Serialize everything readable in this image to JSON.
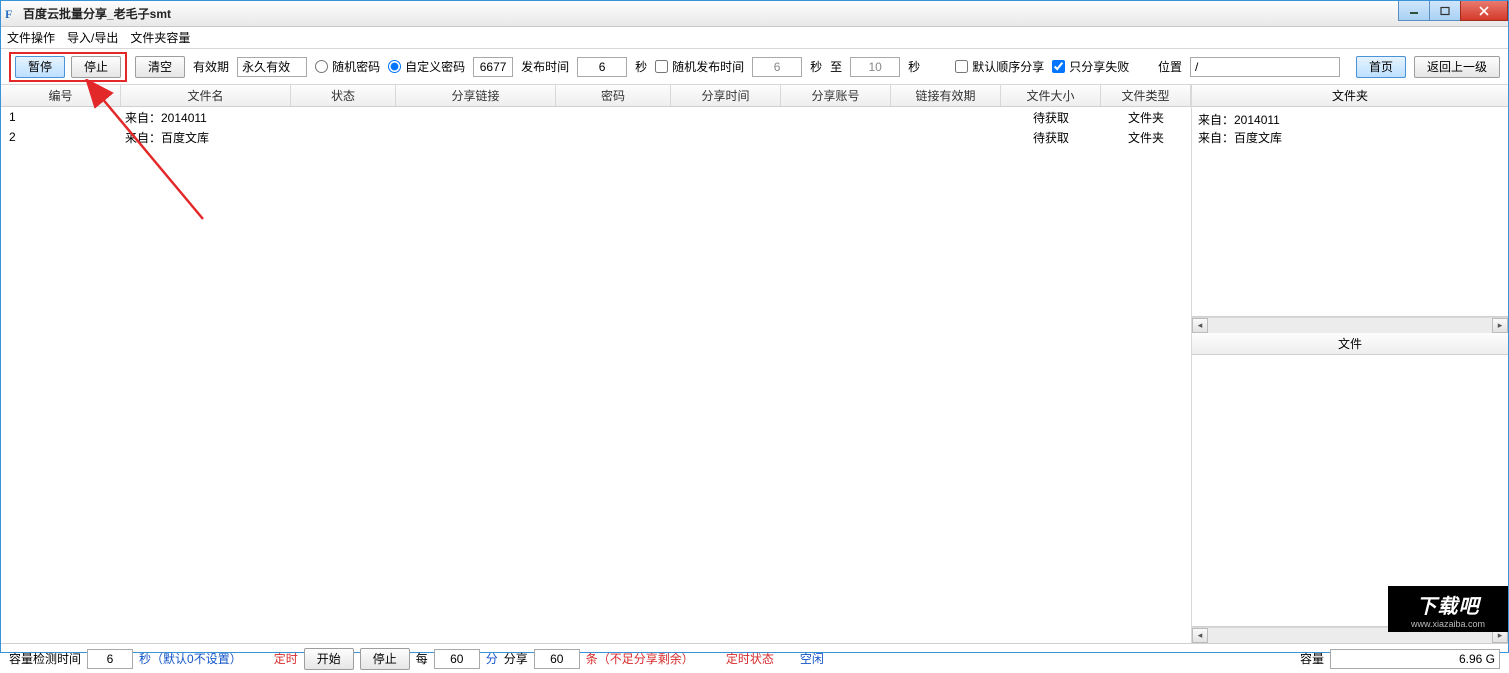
{
  "window": {
    "title": "百度云批量分享_老毛子smt"
  },
  "menu": {
    "file": "文件操作",
    "io": "导入/导出",
    "cap": "文件夹容量"
  },
  "toolbar": {
    "pause": "暂停",
    "stop": "停止",
    "clear": "清空",
    "expiry_label": "有效期",
    "expiry_value": "永久有效",
    "rand_pwd": "随机密码",
    "custom_pwd": "自定义密码",
    "pwd_value": "6677",
    "pub_time_label": "发布时间",
    "pub_time_value": "6",
    "sec": "秒",
    "rand_pub": "随机发布时间",
    "rand_from": "6",
    "to_label": "至",
    "rand_to": "10",
    "sec2": "秒",
    "default_order": "默认顺序分享",
    "only_failed": "只分享失败",
    "loc_label": "位置",
    "loc_value": "/",
    "home": "首页",
    "back": "返回上一级"
  },
  "columns": {
    "id": "编号",
    "name": "文件名",
    "status": "状态",
    "link": "分享链接",
    "pwd": "密码",
    "time": "分享时间",
    "acct": "分享账号",
    "linkexp": "链接有效期",
    "size": "文件大小",
    "type": "文件类型"
  },
  "rows": [
    {
      "id": "1",
      "name": "来自：2014011",
      "size": "待获取",
      "type": "文件夹"
    },
    {
      "id": "2",
      "name": "来自：百度文库",
      "size": "待获取",
      "type": "文件夹"
    }
  ],
  "side": {
    "folders_title": "文件夹",
    "folders": [
      "来自：2014011",
      "来自：百度文库"
    ],
    "files_title": "文件"
  },
  "status": {
    "cap_check_label": "容量检测时间",
    "cap_check_val": "6",
    "cap_check_suffix": "秒（默认0不设置）",
    "timer": "定时",
    "start": "开始",
    "stop": "停止",
    "every": "每",
    "every_val": "60",
    "min": "分",
    "share": "分享",
    "share_val": "60",
    "share_suffix": "条（不足分享剩余）",
    "timer_status": "定时状态",
    "idle": "空闲",
    "capacity_label": "容量",
    "capacity_val": "6.96 G"
  },
  "watermark": {
    "big": "下载吧",
    "small": "www.xiazaiba.com"
  }
}
